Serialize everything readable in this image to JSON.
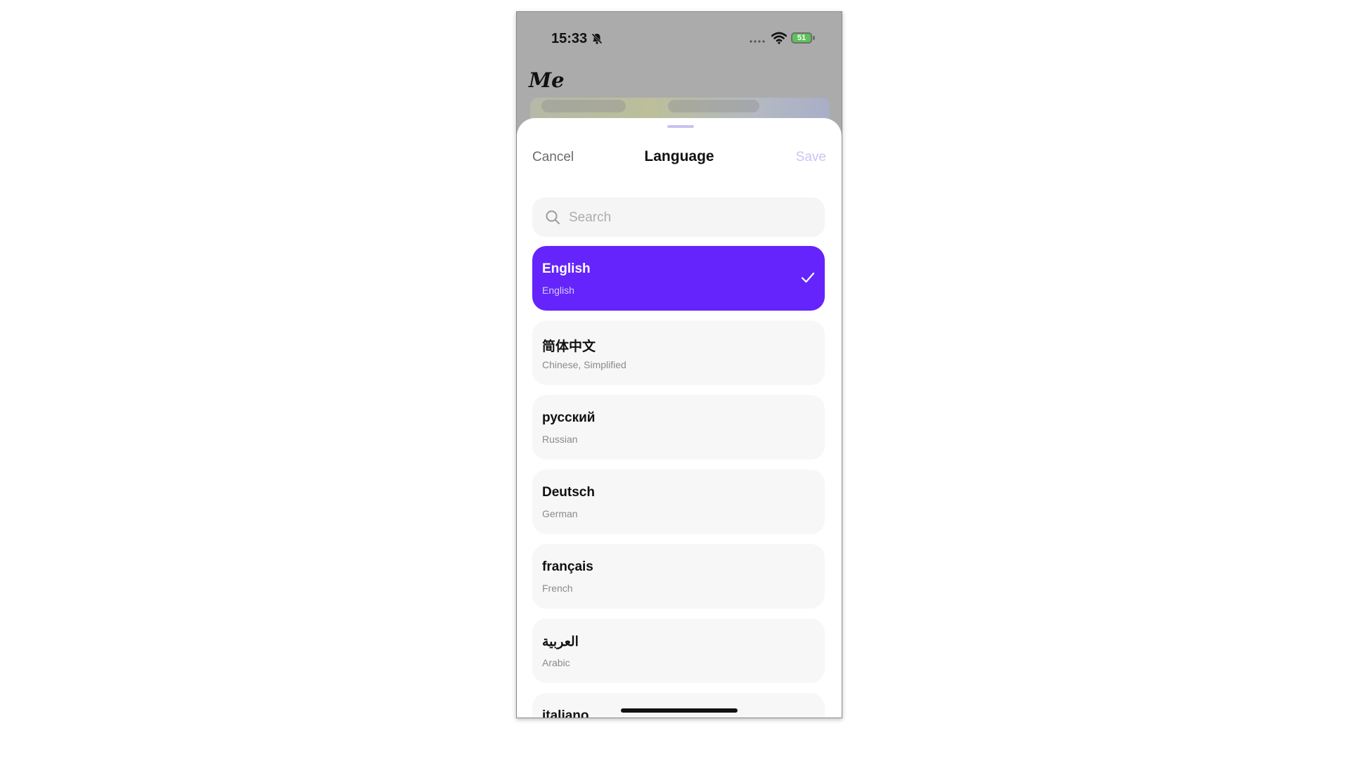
{
  "status_bar": {
    "time": "15:33",
    "battery": "51",
    "icons": [
      "bell-slash-icon",
      "signal-icon",
      "wifi-icon",
      "battery-charging-icon"
    ]
  },
  "background": {
    "title": "Me"
  },
  "sheet": {
    "cancel_label": "Cancel",
    "title": "Language",
    "save_label": "Save",
    "search_placeholder": "Search",
    "search_value": "",
    "accent_color": "#6424FB"
  },
  "languages": [
    {
      "name": "English",
      "english_name": "English",
      "selected": true
    },
    {
      "name": "简体中文",
      "english_name": "Chinese, Simplified",
      "selected": false
    },
    {
      "name": "русский",
      "english_name": "Russian",
      "selected": false
    },
    {
      "name": "Deutsch",
      "english_name": "German",
      "selected": false
    },
    {
      "name": "français",
      "english_name": "French",
      "selected": false
    },
    {
      "name": "العربية",
      "english_name": "Arabic",
      "selected": false
    },
    {
      "name": "italiano",
      "english_name": "",
      "selected": false
    }
  ]
}
